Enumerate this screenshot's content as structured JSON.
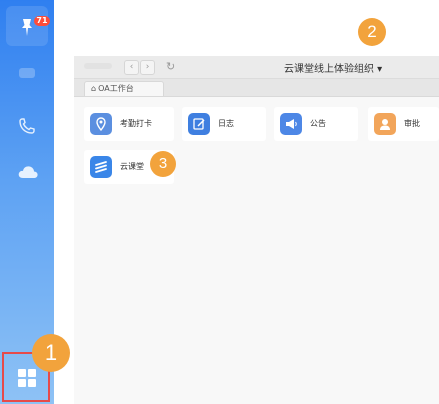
{
  "sidebar": {
    "notification_badge": "71",
    "icons": [
      "pin-icon",
      "phone-icon",
      "cloud-icon",
      "apps-grid-icon"
    ]
  },
  "markers": [
    "1",
    "2",
    "3"
  ],
  "window": {
    "title": "云课堂线上体验组织 ▾",
    "tab_label": "OA工作台",
    "back_symbol": "‹",
    "forward_symbol": "›",
    "refresh_symbol": "↻"
  },
  "apps": [
    {
      "label": "考勤打卡",
      "icon": "location-pin-icon",
      "color": "#5b8fe0"
    },
    {
      "label": "日志",
      "icon": "edit-note-icon",
      "color": "#3f7fe0"
    },
    {
      "label": "公告",
      "icon": "megaphone-icon",
      "color": "#4d87e6"
    },
    {
      "label": "审批",
      "icon": "person-icon",
      "color": "#f2a55a"
    },
    {
      "label": "云课堂",
      "icon": "stack-lines-icon",
      "color": "#3a86e8"
    }
  ],
  "colors": {
    "sidebar_top": "#2f7ff0",
    "sidebar_bottom": "#8ec2f5",
    "marker": "#f2a33c",
    "highlight_border": "#e64a4a"
  }
}
